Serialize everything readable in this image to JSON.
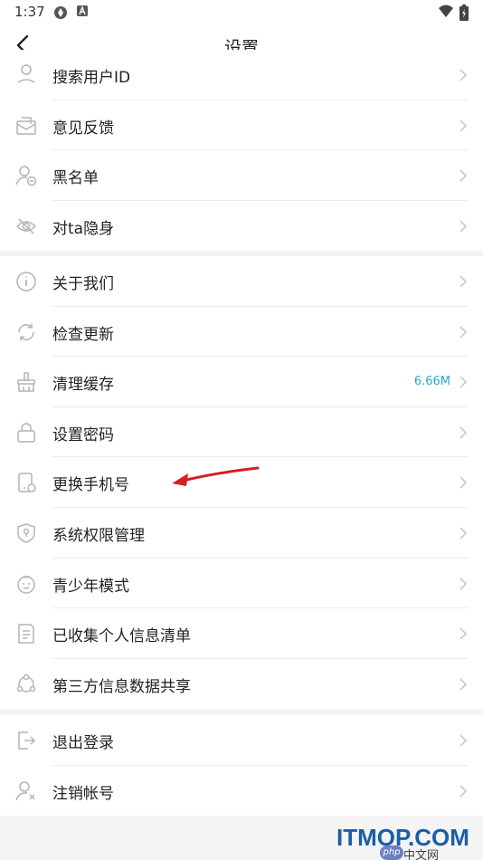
{
  "status_bar": {
    "time": "1:37",
    "icons": [
      "sync-icon",
      "a-badge-icon",
      "wifi-icon",
      "battery-icon"
    ]
  },
  "header": {
    "title": "设置",
    "back_icon": "chevron-left-icon"
  },
  "groups": [
    {
      "items": [
        {
          "label": "搜索用户ID",
          "icon": "search-user-icon"
        },
        {
          "label": "意见反馈",
          "icon": "mail-feedback-icon"
        },
        {
          "label": "黑名单",
          "icon": "user-block-icon"
        },
        {
          "label": "对ta隐身",
          "icon": "eye-hidden-icon"
        }
      ]
    },
    {
      "items": [
        {
          "label": "关于我们",
          "icon": "info-icon"
        },
        {
          "label": "检查更新",
          "icon": "refresh-icon"
        },
        {
          "label": "清理缓存",
          "icon": "broom-icon",
          "value": "6.66M"
        },
        {
          "label": "设置密码",
          "icon": "lock-icon"
        },
        {
          "label": "更换手机号",
          "icon": "phone-change-icon"
        },
        {
          "label": "系统权限管理",
          "icon": "shield-key-icon"
        },
        {
          "label": "青少年模式",
          "icon": "child-face-icon"
        },
        {
          "label": "已收集个人信息清单",
          "icon": "document-list-icon"
        },
        {
          "label": "第三方信息数据共享",
          "icon": "share-icon"
        }
      ]
    },
    {
      "items": [
        {
          "label": "退出登录",
          "icon": "logout-icon"
        },
        {
          "label": "注销帐号",
          "icon": "user-remove-icon"
        }
      ]
    }
  ],
  "annotation": {
    "arrow_color": "#d42020"
  },
  "watermark": {
    "main": "ITMOP.COM",
    "php": "php",
    "sub": "中文网"
  },
  "colors": {
    "accent_value": "#2aa9c9",
    "background": "#f4f4f4",
    "icon_gray": "#b4b4b4"
  }
}
